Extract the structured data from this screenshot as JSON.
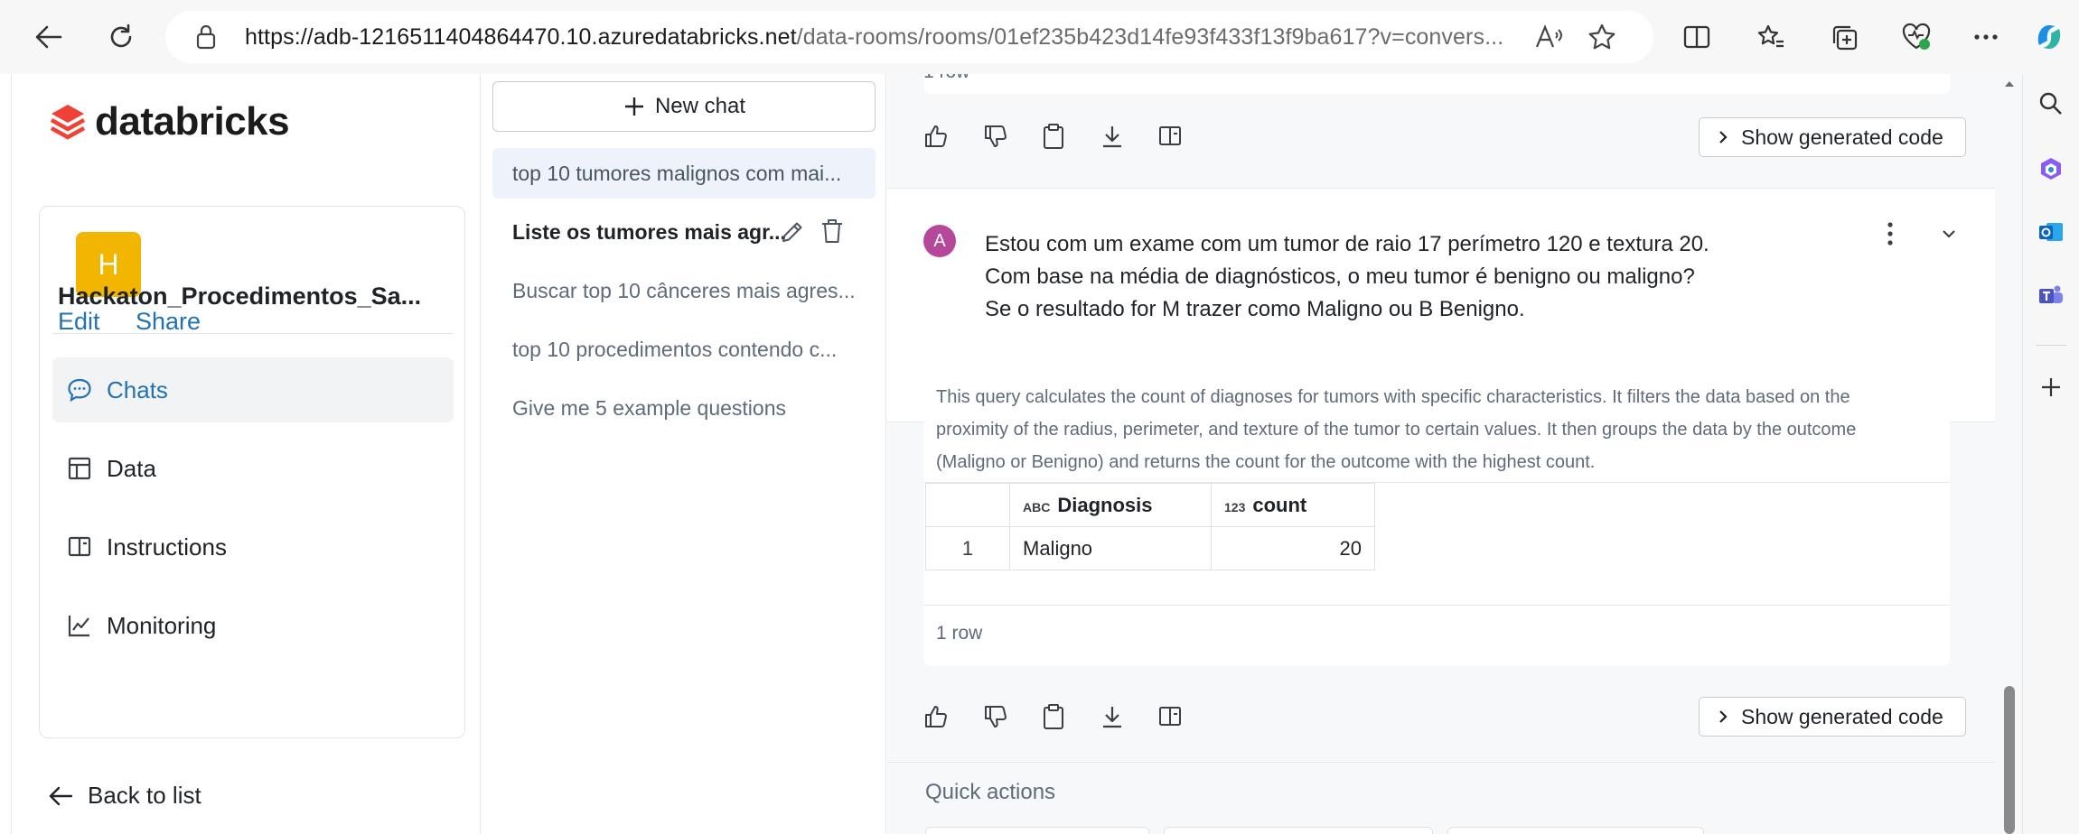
{
  "browser": {
    "url_host": "https://adb-1216511404864470.10.azuredatabricks.net",
    "url_path": "/data-rooms/rooms/01ef235b423d14fe93f433f13f9ba617?v=convers..."
  },
  "app": {
    "brand": "databricks",
    "room": {
      "avatar_letter": "H",
      "name": "Hackaton_Procedimentos_Sa...",
      "edit_label": "Edit",
      "share_label": "Share"
    },
    "nav": [
      {
        "label": "Chats",
        "icon": "chat-icon",
        "active": true
      },
      {
        "label": "Data",
        "icon": "table-icon",
        "active": false
      },
      {
        "label": "Instructions",
        "icon": "book-icon",
        "active": false
      },
      {
        "label": "Monitoring",
        "icon": "chart-line-icon",
        "active": false
      }
    ],
    "back_label": "Back to list"
  },
  "chats": {
    "new_chat_label": "New chat",
    "items": [
      "top 10 tumores malignos com mai...",
      "Liste os tumores mais agr...",
      "Buscar top 10 cânceres mais agres...",
      "top 10 procedimentos contendo c...",
      "Give me 5 example questions"
    ]
  },
  "conversation": {
    "prev_row_count": "1 row",
    "show_code_label": "Show generated code",
    "user_avatar": "A",
    "user_message": [
      "Estou com um exame com um tumor de raio 17 perímetro 120 e textura 20.",
      "Com base na média de diagnósticos, o meu tumor é benigno ou maligno?",
      "Se o resultado for M trazer como Maligno ou B Benigno."
    ],
    "answer_text": [
      "This query calculates the count of diagnoses for tumors with specific characteristics. It filters the data based on the",
      "proximity of the radius, perimeter, and texture of the tumor to certain values. It then groups the data by the outcome",
      "(Maligno or Benigno) and returns the count for the outcome with the highest count."
    ],
    "table": {
      "columns": [
        {
          "type_icon": "ABC",
          "label": "Diagnosis"
        },
        {
          "type_icon": "123",
          "label": "count"
        }
      ],
      "rows": [
        {
          "index": "1",
          "diagnosis": "Maligno",
          "count": "20"
        }
      ]
    },
    "row_count": "1 row",
    "quick_actions_label": "Quick actions"
  },
  "colors": {
    "accent_blue": "#2272b4",
    "avatar_yellow": "#f2b600",
    "user_avatar_purple": "#b5489a",
    "databricks_red": "#ef4135"
  }
}
